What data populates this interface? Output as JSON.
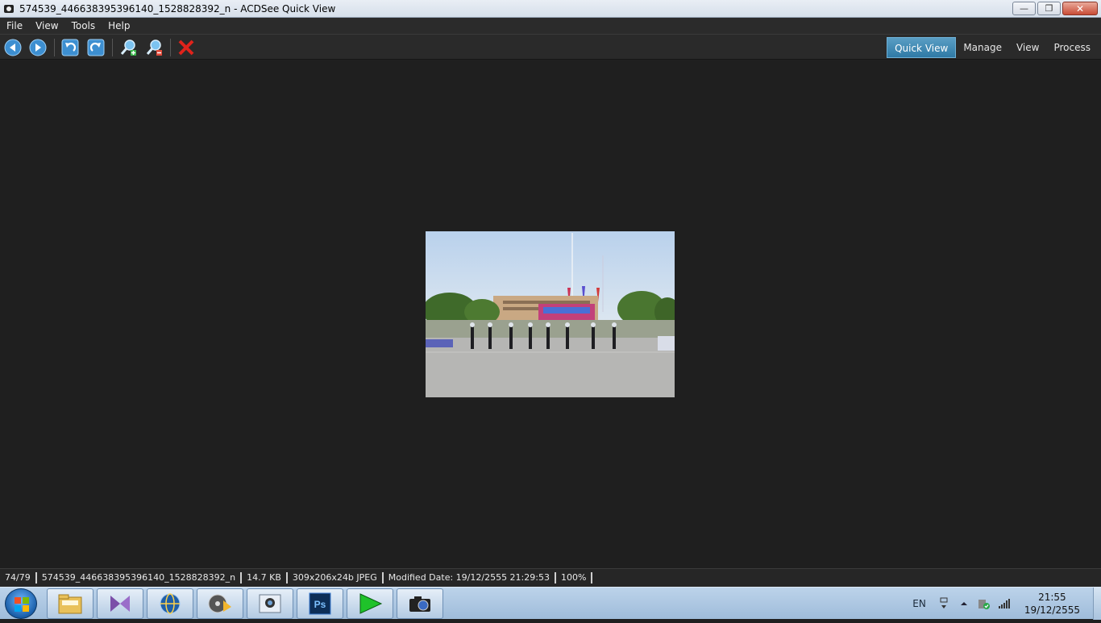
{
  "window": {
    "title": "574539_446638395396140_1528828392_n - ACDSee Quick View",
    "minimize": "—",
    "maximize": "❐",
    "close": "✕"
  },
  "menu": {
    "items": [
      "File",
      "View",
      "Tools",
      "Help"
    ]
  },
  "toolbar": {
    "icons": [
      "previous-icon",
      "next-icon",
      "rotate-left-icon",
      "rotate-right-icon",
      "zoom-in-icon",
      "zoom-out-icon",
      "delete-icon"
    ],
    "modes": [
      "Quick View",
      "Manage",
      "View",
      "Process"
    ],
    "active_mode": "Quick View",
    "accent": "#3a86b3"
  },
  "statusbar": {
    "position": "74/79",
    "filename": "574539_446638395396140_1528828392_n",
    "filesize": "14.7 KB",
    "dimensions": "309x206x24b JPEG",
    "modified": "Modified Date: 19/12/2555 21:29:53",
    "zoom": "100%"
  },
  "taskbar": {
    "apps": [
      "file-explorer-icon",
      "visual-studio-icon",
      "browser-globe-icon",
      "media-player-icon",
      "photo-viewer-icon",
      "photoshop-icon",
      "play-arrow-icon",
      "camera-icon"
    ],
    "photoshop_label": "Ps",
    "language": "EN",
    "time": "21:55",
    "date": "19/12/2555"
  }
}
